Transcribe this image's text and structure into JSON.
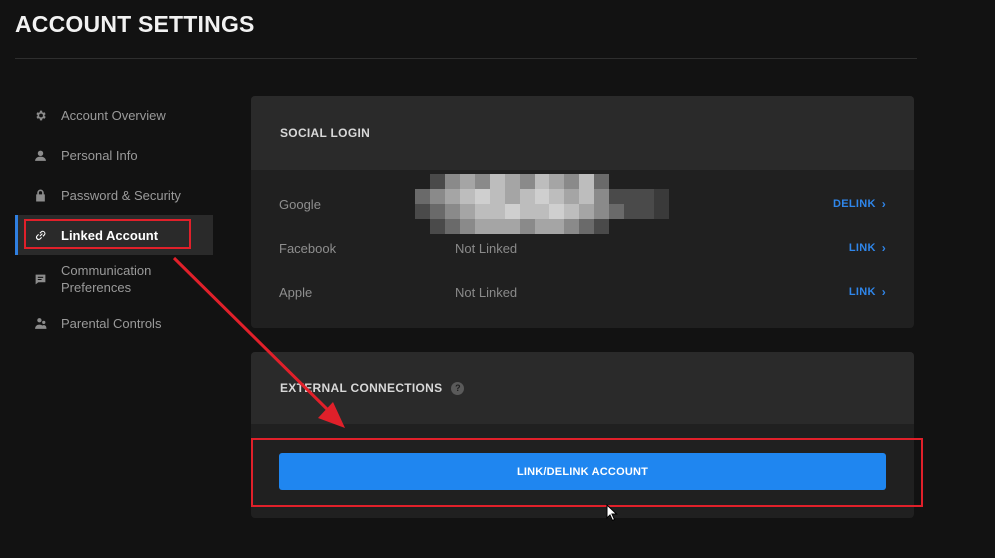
{
  "header": {
    "title": "ACCOUNT SETTINGS"
  },
  "sidebar": {
    "items": [
      {
        "label": "Account Overview",
        "icon": "gear-icon"
      },
      {
        "label": "Personal Info",
        "icon": "user-icon"
      },
      {
        "label": "Password & Security",
        "icon": "lock-icon"
      },
      {
        "label": "Linked Account",
        "icon": "link-icon",
        "active": true
      },
      {
        "label": "Communication Preferences",
        "icon": "chat-icon"
      },
      {
        "label": "Parental Controls",
        "icon": "family-icon"
      }
    ]
  },
  "social_login": {
    "heading": "SOCIAL LOGIN",
    "rows": [
      {
        "service": "Google",
        "status": "",
        "action": "DELINK"
      },
      {
        "service": "Facebook",
        "status": "Not Linked",
        "action": "LINK"
      },
      {
        "service": "Apple",
        "status": "Not Linked",
        "action": "LINK"
      }
    ]
  },
  "external_connections": {
    "heading": "EXTERNAL CONNECTIONS",
    "help_icon": "?",
    "button_label": "LINK/DELINK ACCOUNT"
  },
  "colors": {
    "background": "#121212",
    "panel": "#202020",
    "panel_header": "#2a2a2a",
    "accent_blue": "#1f86f0",
    "link_text": "#2f86ea",
    "annotation_red": "#e0202a"
  }
}
